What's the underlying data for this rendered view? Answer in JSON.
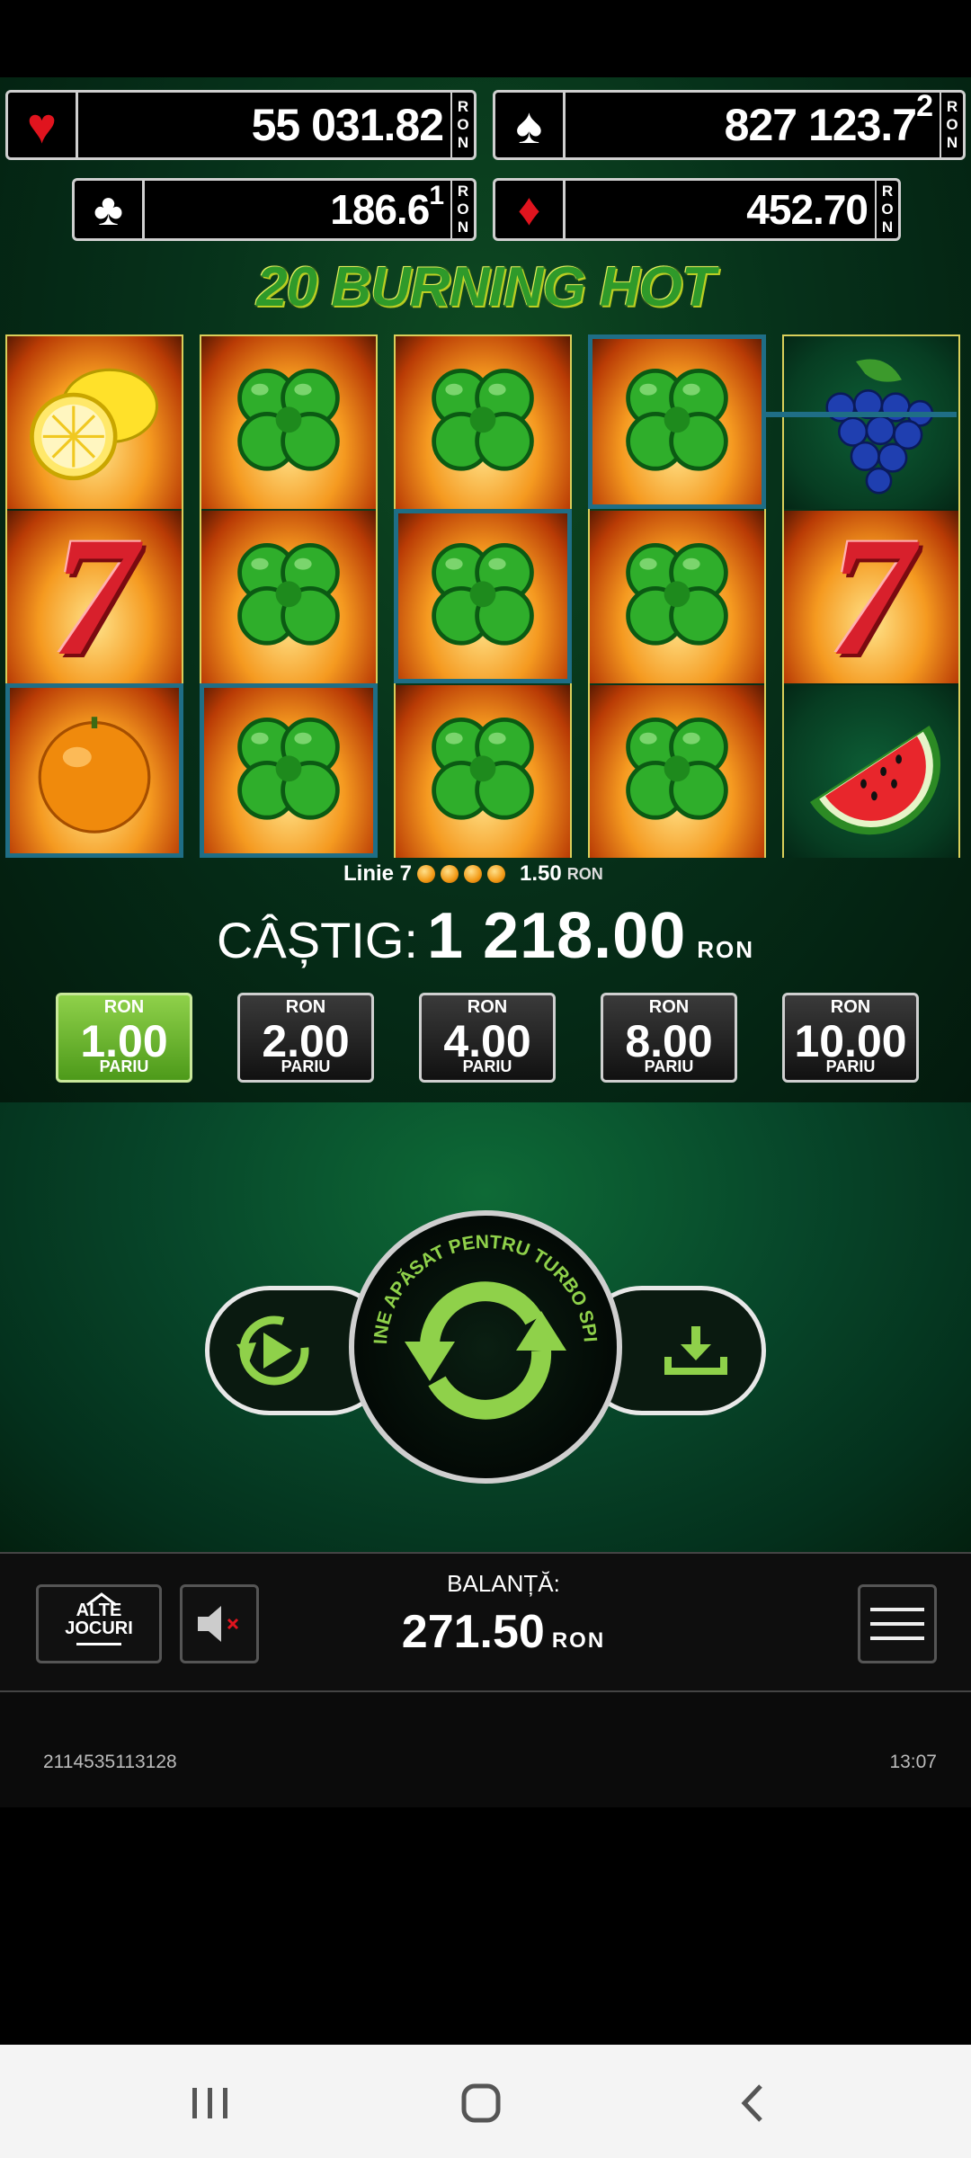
{
  "jackpots": {
    "hearts": {
      "value": "55 031.82",
      "cur": [
        "R",
        "O",
        "N"
      ],
      "suit": "♥",
      "color": "#e0141e"
    },
    "spades": {
      "value": "827 123.7",
      "cur": [
        "R",
        "O",
        "N"
      ],
      "suit": "♠",
      "color": "#ffffff",
      "overflow": "2"
    },
    "clubs": {
      "value": "186.6",
      "cur": [
        "R",
        "O",
        "N"
      ],
      "suit": "♣",
      "color": "#ffffff",
      "overflow": "1"
    },
    "diamonds": {
      "value": "452.70",
      "cur": [
        "R",
        "O",
        "N"
      ],
      "suit": "♦",
      "color": "#e0141e"
    }
  },
  "game_title": "20 BURNING HOT",
  "reels": [
    [
      "lemon",
      "seven",
      "orange"
    ],
    [
      "clover",
      "clover",
      "clover"
    ],
    [
      "clover",
      "clover",
      "clover"
    ],
    [
      "clover",
      "clover",
      "clover"
    ],
    [
      "grapes",
      "seven",
      "watermelon"
    ]
  ],
  "line_info": {
    "label": "Linie 7",
    "amount": "1.50",
    "currency": "RON"
  },
  "win": {
    "label": "CÂȘTIG:",
    "amount": "1 218.00",
    "currency": "RON"
  },
  "bets": [
    {
      "currency": "RON",
      "value": "1.00",
      "label": "PARIU",
      "active": true
    },
    {
      "currency": "RON",
      "value": "2.00",
      "label": "PARIU",
      "active": false
    },
    {
      "currency": "RON",
      "value": "4.00",
      "label": "PARIU",
      "active": false
    },
    {
      "currency": "RON",
      "value": "8.00",
      "label": "PARIU",
      "active": false
    },
    {
      "currency": "RON",
      "value": "10.00",
      "label": "PARIU",
      "active": false
    }
  ],
  "spin": {
    "ring_text": "ȚINE APĂSAT PENTRU TURBO SPIN"
  },
  "bottom": {
    "other_games_line1": "ALTE",
    "other_games_line2": "JOCURI",
    "balance_label": "BALANȚĂ:",
    "balance_amount": "271.50",
    "balance_currency": "RON"
  },
  "footer": {
    "session_id": "2114535113128",
    "time": "13:07"
  },
  "colors": {
    "accent_green": "#8fd14a",
    "payline": "#1f6e86"
  }
}
